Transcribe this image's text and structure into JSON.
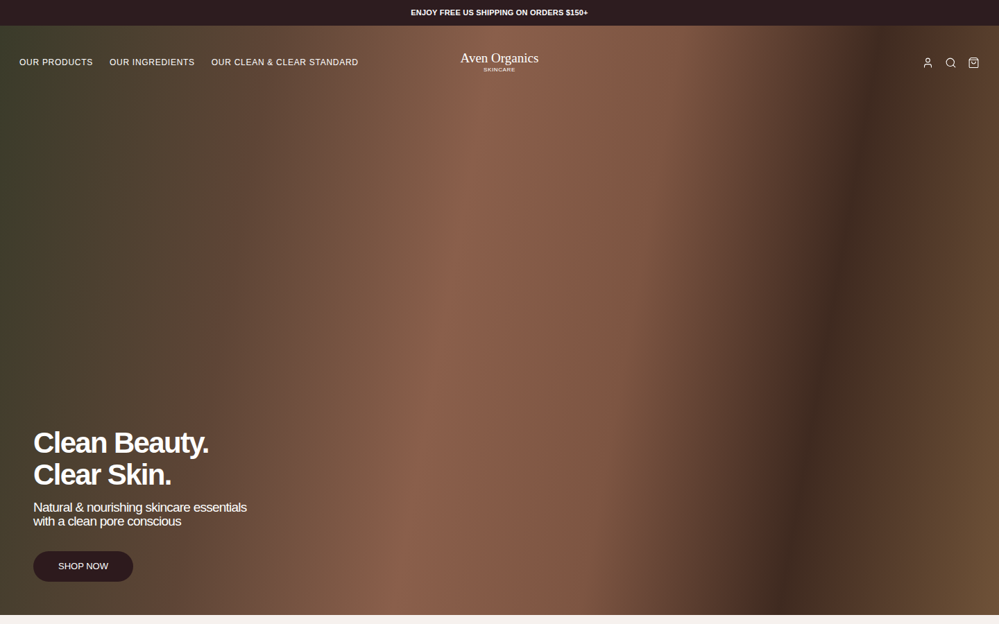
{
  "announcement": "ENJOY FREE US SHIPPING ON ORDERS $150+",
  "nav": {
    "links": [
      "OUR PRODUCTS",
      "OUR INGREDIENTS",
      "OUR CLEAN & CLEAR STANDARD"
    ]
  },
  "logo": {
    "name": "Aven Organics",
    "tagline": "SKINCARE"
  },
  "hero": {
    "title_lines": [
      "Clean Beauty.",
      "Clear Skin."
    ],
    "subtitle_lines": [
      "Natural & nourishing skincare essentials",
      "with a clean pore conscious"
    ],
    "button": "SHOP NOW"
  }
}
